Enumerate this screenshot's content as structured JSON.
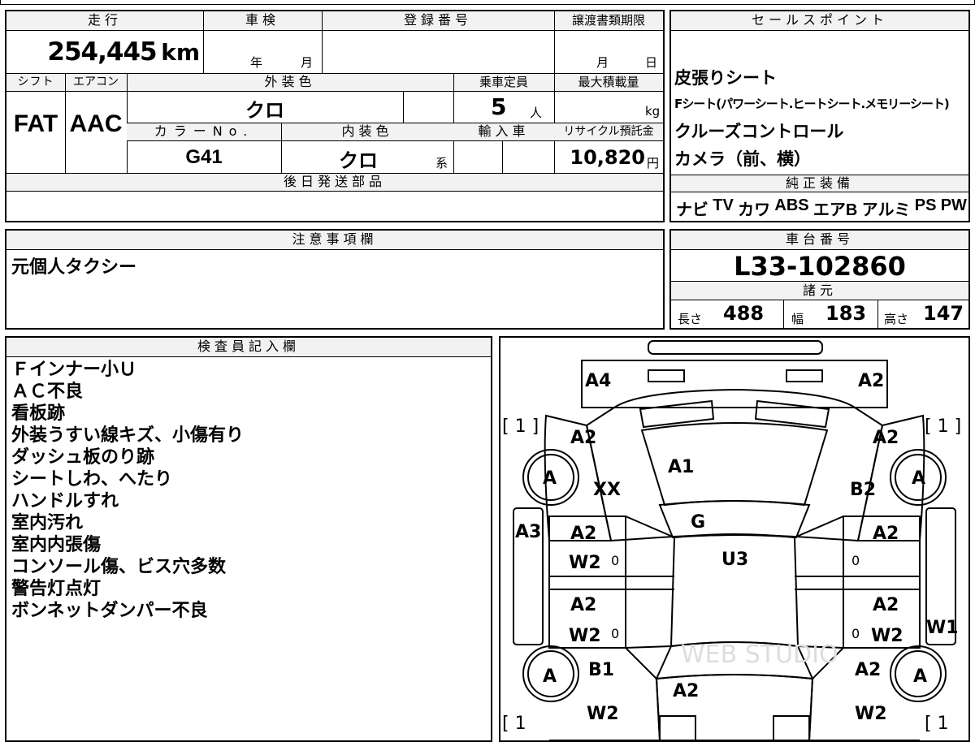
{
  "spec": {
    "mileage_label": "走行",
    "mileage_value": "254,445",
    "mileage_unit": "km",
    "inspection_label": "車検",
    "inspection_year": "年",
    "inspection_month": "月",
    "registration_label": "登録番号",
    "transfer_label": "譲渡書類期限",
    "transfer_month": "月",
    "transfer_day": "日",
    "shift_label": "シフト",
    "shift_value": "FAT",
    "ac_label": "エアコン",
    "ac_value": "AAC",
    "exterior_color_label": "外装色",
    "exterior_color_value": "クロ",
    "capacity_label": "乗車定員",
    "capacity_value": "5",
    "capacity_unit": "人",
    "max_load_label": "最大積載量",
    "max_load_unit": "kg",
    "color_no_label": "カラーNo.",
    "color_no_value": "G41",
    "interior_color_label": "内装色",
    "interior_color_value": "クロ",
    "interior_color_suffix": "系",
    "import_label": "輸入車",
    "recycle_label": "リサイクル預託金",
    "recycle_value": "10,820",
    "recycle_unit": "円",
    "later_parts_label": "後日発送部品"
  },
  "sales_points": {
    "title": "セールスポイント",
    "lines": [
      "皮張りシート",
      "Fシート(パワーシート.ヒートシート.メモリーシート)",
      "クルーズコントロール",
      "カメラ（前、横）"
    ]
  },
  "equipment": {
    "title": "純正装備",
    "items": [
      "ナビ",
      "TV",
      "カワ",
      "ABS",
      "エアB",
      "アルミ",
      "PS",
      "PW"
    ]
  },
  "notes": {
    "title": "注意事項欄",
    "text": "元個人タクシー"
  },
  "chassis": {
    "title": "車台番号",
    "value": "L33-102860"
  },
  "dimensions": {
    "title": "諸元",
    "length_label": "長さ",
    "length_value": "488",
    "width_label": "幅",
    "width_value": "183",
    "height_label": "高さ",
    "height_value": "147"
  },
  "inspector": {
    "title": "検査員記入欄",
    "lines": [
      "Ｆインナー小Ｕ",
      "ＡＣ不良",
      "看板跡",
      "外装うすい線キズ、小傷有り",
      "ダッシュ板のり跡",
      "シートしわ、へたり",
      "ハンドルすれ",
      "室内汚れ",
      "室内内張傷",
      "コンソール傷、ビス穴多数",
      "警告灯点灯",
      "ボンネットダンパー不良"
    ]
  },
  "diagram": {
    "watermark": "WEB STUDIO",
    "tire_marks": [
      "[ 1 ]",
      "[ 1 ]",
      "[ 1",
      "[ 1"
    ],
    "wheel_label": "A",
    "codes": {
      "front_left": "A4",
      "front_right": "A2",
      "fender_fl": "A2",
      "fender_fr": "A2",
      "hood": "A1",
      "front_left_xx": "XX",
      "front_right_b2": "B2",
      "windshield": "G",
      "roof": "U3",
      "sill_left": "A3",
      "door_fl": "A2",
      "door_fl_w": "W2",
      "door_fr": "A2",
      "door_rl": "A2",
      "door_rl_w": "W2",
      "door_rr": "A2",
      "door_rr_w": "W2",
      "sill_right": "W1",
      "rear_left_b1": "B1",
      "trunk": "A2",
      "quarter_rr": "A2",
      "rear_left_w2": "W2",
      "rear_right_w2": "W2",
      "zero_mark": "0"
    }
  }
}
